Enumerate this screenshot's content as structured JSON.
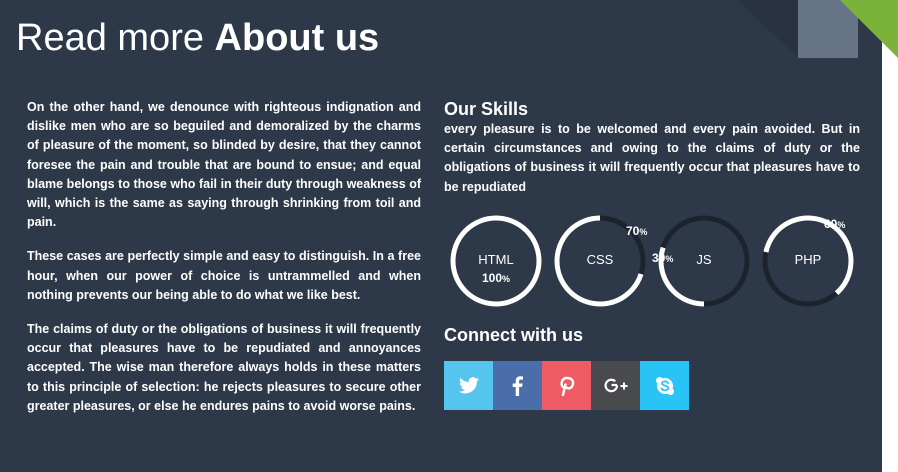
{
  "header": {
    "title_light": "Read more",
    "title_bold": "About us"
  },
  "about": {
    "paragraphs": [
      "On the other hand, we denounce with righteous indignation and dislike men who are so beguiled and demoralized by the charms of pleasure of the moment, so blinded by desire, that they cannot foresee the pain and trouble that are bound to ensue; and equal blame belongs to those who fail in their duty through weakness of will, which is the same as saying through shrinking from toil and pain.",
      "These cases are perfectly simple and easy to distinguish. In a free hour, when our power of choice is untrammelled and when nothing prevents our being able to do what we like best.",
      "The claims of duty or the obligations of business it will frequently occur that pleasures have to be repudiated and annoyances accepted. The wise man therefore always holds in these matters to this principle of selection: he rejects pleasures to secure other greater pleasures, or else he endures pains to avoid worse pains."
    ]
  },
  "skills": {
    "heading": "Our Skills",
    "text": "every pleasure is to be welcomed and every pain avoided. But in certain circumstances and owing to the claims of duty or the obligations of business it will frequently occur that pleasures have to be repudiated",
    "items": [
      {
        "name": "HTML",
        "percent": 100,
        "percent_label": "100",
        "unit": "%"
      },
      {
        "name": "CSS",
        "percent": 70,
        "percent_label": "70",
        "unit": "%"
      },
      {
        "name": "JS",
        "percent": 30,
        "percent_label": "30",
        "unit": "%"
      },
      {
        "name": "PHP",
        "percent": 60,
        "percent_label": "60",
        "unit": "%"
      }
    ]
  },
  "connect": {
    "heading": "Connect with us",
    "networks": [
      {
        "name": "twitter",
        "icon": "twitter-icon",
        "color": "#55c5ef"
      },
      {
        "name": "facebook",
        "icon": "facebook-icon",
        "color": "#4a6eaa"
      },
      {
        "name": "pinterest",
        "icon": "pinterest-icon",
        "color": "#ef5b64"
      },
      {
        "name": "google-plus",
        "icon": "google-plus-icon",
        "color": "#494a4e"
      },
      {
        "name": "skype",
        "icon": "skype-icon",
        "color": "#27c4f5"
      }
    ]
  },
  "colors": {
    "background": "#2d3848",
    "ring_fill": "#ffffff",
    "ring_track": "#1d232d",
    "corner_green": "#7bb33a",
    "corner_slate": "#657487"
  }
}
